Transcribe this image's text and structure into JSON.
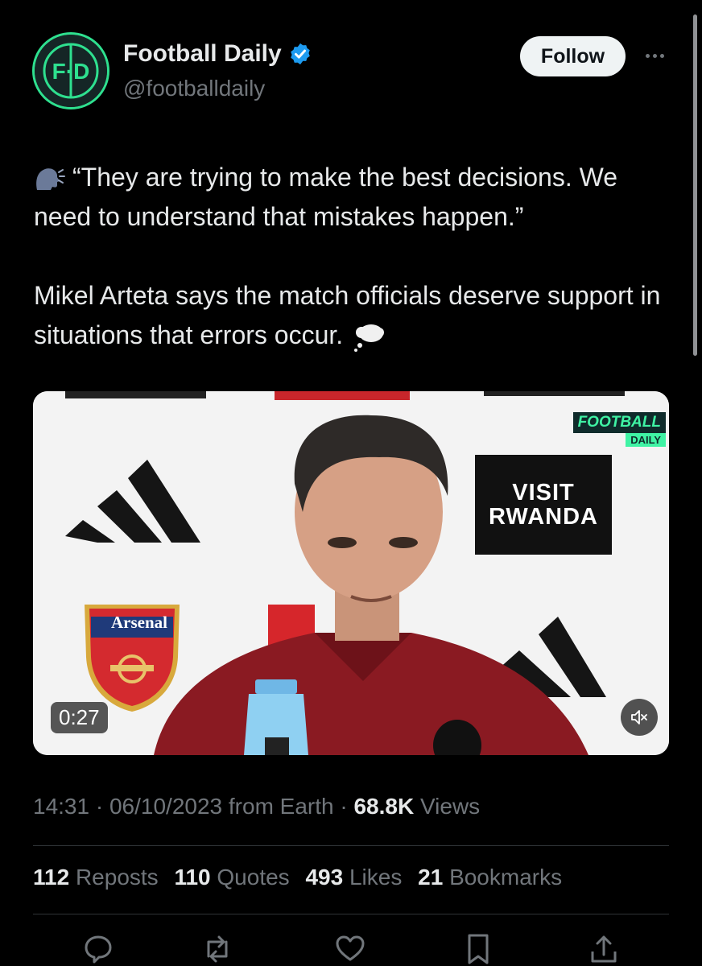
{
  "account": {
    "display_name": "Football Daily",
    "handle": "@footballdaily",
    "avatar_text": "F·D",
    "verified": true
  },
  "header": {
    "follow_label": "Follow"
  },
  "tweet": {
    "line1": "“They are trying to make the best decisions. We need to understand that mistakes happen.”",
    "line2": "Mikel Arteta says the match officials deserve support in situations that errors occur."
  },
  "video": {
    "duration": "0:27",
    "watermark_line1": "FOOTBALL",
    "watermark_line2": "DAILY",
    "board_line1": "VISIT",
    "board_line2": "RWANDA",
    "crest_text": "Arsenal"
  },
  "meta": {
    "time": "14:31",
    "date": "06/10/2023",
    "source": "from Earth",
    "views_count": "68.8K",
    "views_label": "Views"
  },
  "stats": {
    "reposts_count": "112",
    "reposts_label": "Reposts",
    "quotes_count": "110",
    "quotes_label": "Quotes",
    "likes_count": "493",
    "likes_label": "Likes",
    "bookmarks_count": "21",
    "bookmarks_label": "Bookmarks"
  },
  "colors": {
    "background": "#000000",
    "text_primary": "#e7e9ea",
    "text_secondary": "#71767b",
    "verified_blue": "#1d9bf0",
    "brand_green": "#2ee08f"
  },
  "icons": [
    "speaking-head-icon",
    "thought-balloon-icon",
    "verified-badge-icon",
    "more-icon",
    "mute-icon",
    "reply-icon",
    "repost-icon",
    "like-icon",
    "bookmark-icon",
    "share-icon"
  ]
}
